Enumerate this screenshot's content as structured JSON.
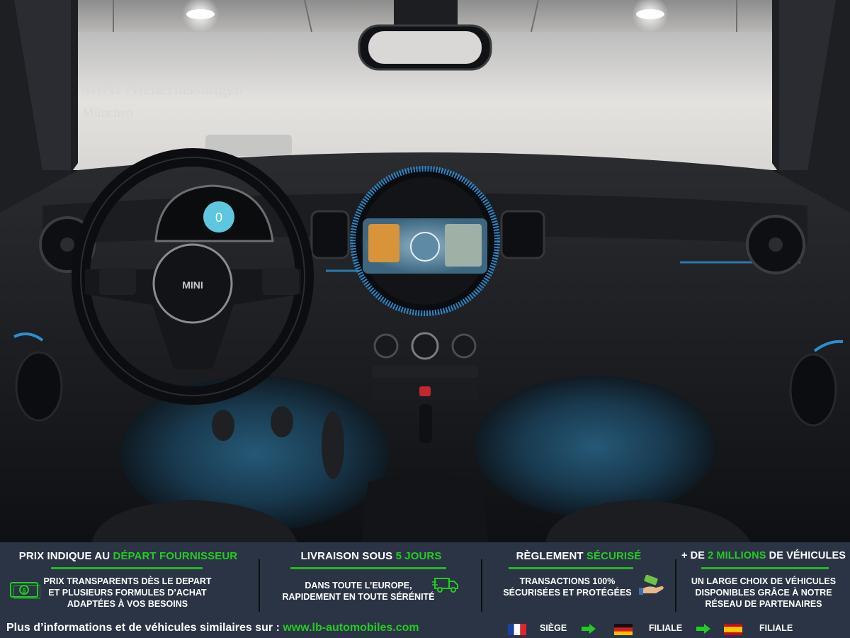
{
  "photo": {
    "dealer_name": "MINI Niederlassungen",
    "dealer_city": "München",
    "speed_display": "0",
    "steering_badge": "MINI"
  },
  "banner": {
    "columns": [
      {
        "title_prefix": "PRIX INDIQUE AU ",
        "title_highlight": "DÉPART FOURNISSEUR",
        "title_suffix": "",
        "lines": [
          "PRIX TRANSPARENTS DÈS LE DEPART",
          "ET PLUSIEURS FORMULES D’ACHAT",
          "ADAPTÉES À VOS BESOINS"
        ],
        "icon": "money-icon"
      },
      {
        "title_prefix": "LIVRAISON SOUS ",
        "title_highlight": "5 JOURS",
        "title_suffix": "",
        "lines": [
          "DANS TOUTE L’EUROPE,",
          "RAPIDEMENT EN TOUTE SÉRÉNITÉ"
        ],
        "icon": "delivery-truck-icon"
      },
      {
        "title_prefix": "RÈGLEMENT ",
        "title_highlight": "SÉCURISÉ",
        "title_suffix": "",
        "lines": [
          "TRANSACTIONS 100%",
          "SÉCURISÉES ET PROTÉGÉES"
        ],
        "icon": "payment-hand-icon"
      },
      {
        "title_prefix": "+ DE ",
        "title_highlight": "2 MILLIONS",
        "title_suffix": " DE VÉHICULES",
        "lines": [
          "UN LARGE CHOIX DE VÉHICULES",
          "DISPONIBLES GRÂCE À NOTRE",
          "RÉSEAU DE PARTENAIRES"
        ],
        "icon": ""
      }
    ],
    "footer": {
      "info_text": "Plus d’informations et de véhicules similaires sur : ",
      "link_text": "www.lb-automobiles.com",
      "locations": [
        {
          "flag": "france-flag-icon",
          "label": "SIÈGE"
        },
        {
          "flag": "germany-flag-icon",
          "label": "FILIALE"
        },
        {
          "flag": "spain-flag-icon",
          "label": "FILIALE"
        }
      ]
    }
  },
  "colors": {
    "banner_bg": "#2b3444",
    "accent_green": "#22cc22",
    "ambient_blue": "#2e8fd0"
  }
}
